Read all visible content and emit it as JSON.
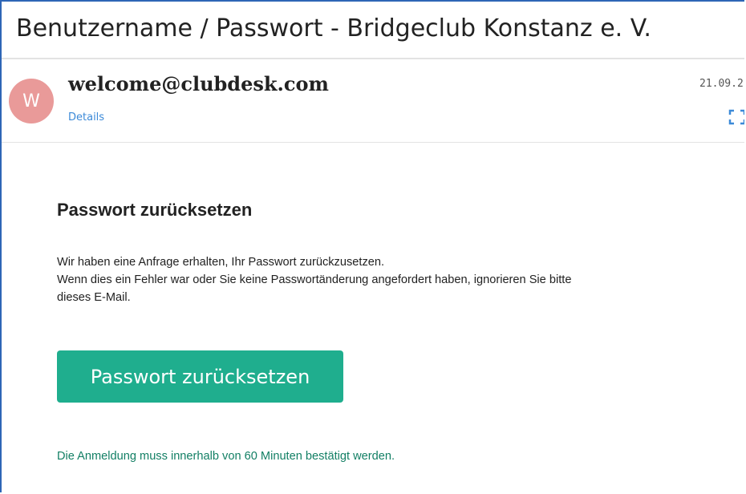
{
  "email": {
    "subject": "Benutzername / Passwort - Bridgeclub Konstanz e. V.",
    "sender": {
      "avatar_letter": "W",
      "address": "welcome@clubdesk.com",
      "details_label": "Details",
      "date": "21.09.2"
    },
    "expand_icon": "expand-icon"
  },
  "body": {
    "heading": "Passwort zurücksetzen",
    "paragraph": [
      "Wir haben eine Anfrage erhalten, Ihr Passwort zurückzusetzen.",
      "Wenn dies ein Fehler war oder Sie keine Passwortänderung angefordert haben, ignorieren Sie bitte",
      "dieses E-Mail."
    ],
    "button_label": "Passwort zurücksetzen",
    "note": "Die Anmeldung muss innerhalb von 60 Minuten bestätigt werden."
  },
  "colors": {
    "frame_border": "#2e66b6",
    "avatar_bg": "#e99a99",
    "link": "#3c8ad8",
    "button_bg": "#1fae8e",
    "note_text": "#127f64"
  }
}
